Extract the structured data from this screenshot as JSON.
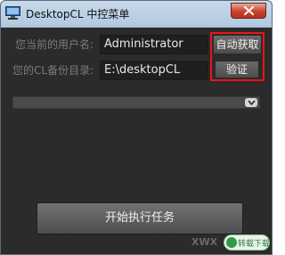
{
  "window": {
    "title": "DesktopCL 中控菜单",
    "icon": "monitor-icon",
    "close_icon": "close-icon"
  },
  "form": {
    "username_label": "您当前的用户名:",
    "username_value": "Administrator",
    "auto_fetch_button": "自动获取",
    "backup_dir_label": "您的CL备份目录:",
    "backup_dir_value": "E:\\desktopCL",
    "verify_button": "验证",
    "dropdown_value": "",
    "dropdown_icon": "chevron-down-icon"
  },
  "actions": {
    "start_button": "开始执行任务"
  },
  "watermark": {
    "logo": "XWX",
    "badge": "转载下载"
  },
  "colors": {
    "highlight_frame": "#e8141d",
    "window_bg": "#2b2b2b",
    "titlebar": "#b2c9df",
    "close_button": "#c8432d"
  }
}
